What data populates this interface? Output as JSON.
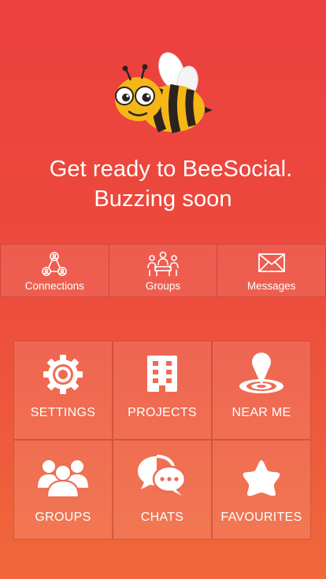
{
  "headline": {
    "line1": "Get ready to BeeSocial.",
    "line2": "Buzzing soon"
  },
  "topbar": [
    {
      "label": "Connections",
      "icon": "connections-icon"
    },
    {
      "label": "Groups",
      "icon": "groups-icon"
    },
    {
      "label": "Messages",
      "icon": "envelope-icon"
    }
  ],
  "grid": [
    {
      "label": "SETTINGS",
      "icon": "gear-icon"
    },
    {
      "label": "PROJECTS",
      "icon": "building-icon"
    },
    {
      "label": "NEAR ME",
      "icon": "location-pin-icon"
    },
    {
      "label": "GROUPS",
      "icon": "people-icon"
    },
    {
      "label": "CHATS",
      "icon": "chat-bubbles-icon"
    },
    {
      "label": "FAVOURITES",
      "icon": "star-icon"
    }
  ],
  "colors": {
    "background_top": "#ec3f3f",
    "background_bottom": "#f0683a",
    "text": "#ffffff"
  }
}
